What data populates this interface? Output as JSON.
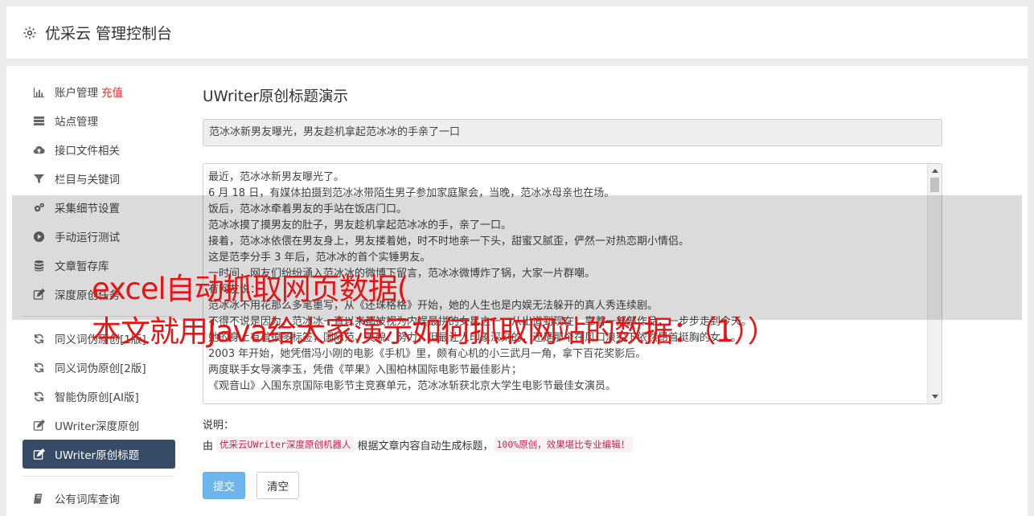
{
  "header": {
    "title": "优采云 管理控制台",
    "icon": "gear-icon"
  },
  "sidebar": {
    "group1": [
      {
        "label": "账户管理",
        "badge": "充值",
        "icon": "bar-chart-icon"
      },
      {
        "label": "站点管理",
        "icon": "server-icon"
      },
      {
        "label": "接口文件相关",
        "icon": "cloud-upload-icon"
      },
      {
        "label": "栏目与关键词",
        "icon": "filter-icon"
      },
      {
        "label": "采集细节设置",
        "icon": "cogs-icon"
      },
      {
        "label": "手动运行测试",
        "icon": "play-circle-icon"
      },
      {
        "label": "文章暂存库",
        "icon": "database-icon"
      },
      {
        "label": "深度原创任务",
        "icon": "edit-icon"
      }
    ],
    "group2": [
      {
        "label": "同义词伪原创[1版]",
        "icon": "refresh-icon"
      },
      {
        "label": "同义词伪原创[2版]",
        "icon": "refresh-icon"
      },
      {
        "label": "智能伪原创[AI版]",
        "icon": "refresh-icon"
      },
      {
        "label": "UWriter深度原创",
        "icon": "edit-icon"
      },
      {
        "label": "UWriter原创标题",
        "icon": "edit-icon",
        "active": true
      }
    ],
    "group3": [
      {
        "label": "公有词库查询",
        "icon": "book-icon"
      }
    ]
  },
  "main": {
    "heading": "UWriter原创标题演示",
    "title_value": "范冰冰新男友曝光，男友趁机拿起范冰冰的手亲了一口",
    "content_lines": [
      "最近，范冰冰新男友曝光了。",
      "6 月 18 日，有媒体拍摄到范冰冰带陌生男子参加家庭聚会，当晚，范冰冰母亲也在场。",
      "饭后，范冰冰牵着男友的手站在饭店门口。",
      "范冰冰摸了摸男友的肚子，男友趁机拿起范冰冰的手，亲了一口。",
      "接着，范冰冰依偎在男友身上，男友搂着她，时不时地亲一下头，甜蜜又腻歪，俨然一对热恋期小情侣。",
      "这是范李分手 3 年后，范冰冰的首个实锤男友。",
      "一时间，网友们纷纷涌入范冰冰的微博下留言，范冰冰微博炸了锅，大家一片群嘲。",
      "有网友说：",
      "范冰冰不用花那么多笔墨写，从《还珠格格》开始，她的人生也是内娱无法躲开的真人秀连续剧。",
      "不得不说是因为，范冰冰一直以来都被视为内娱最拼的女星之一，从出道到现在，靠着一部部作品，一步步走到今天。",
      "她的身上有着很多标签，国际范、美貌、努力，但最让人印象深刻的，还是那个在风口浪尖下依然昂首挺胸的女人。",
      "2003 年开始，她凭借冯小刚的电影《手机》里，颇有心机的小三武月一角，拿下百花奖影后。",
      "两度联手女导演李玉，凭借《苹果》入围柏林国际电影节最佳影片；",
      "《观音山》入围东京国际电影节主竞赛单元，范冰冰斩获北京大学生电影节最佳女演员。"
    ],
    "note_label": "说明：",
    "note_prefix": "由",
    "note_code1": "优采云UWriter深度原创机器人",
    "note_middle": "根据文章内容自动生成标题，",
    "note_code2": "100%原创，效果堪比专业编辑！",
    "submit_label": "提交",
    "clear_label": "清空"
  },
  "overlay": {
    "line1": "excel自动抓取网页数据(",
    "line2": "本文就用Java给大家演示如何抓取网站的数据：（1））"
  }
}
